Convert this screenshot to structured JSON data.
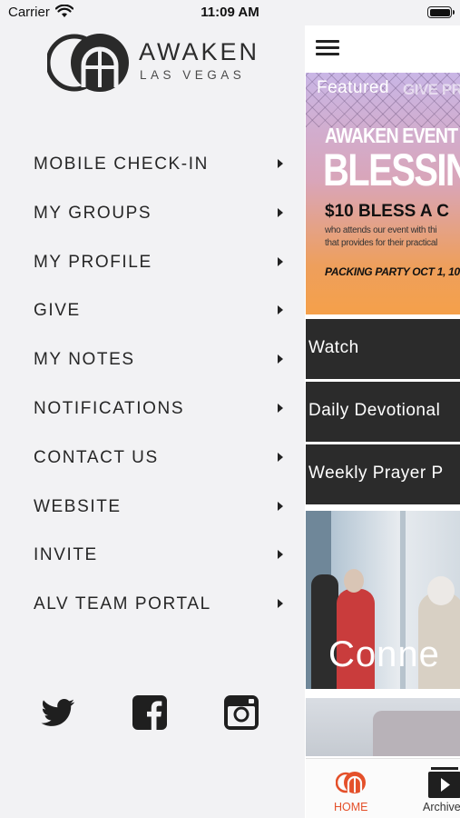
{
  "status_bar": {
    "carrier": "Carrier",
    "time": "11:09 AM"
  },
  "logo": {
    "title": "AWAKEN",
    "subtitle": "LAS VEGAS"
  },
  "menu": [
    {
      "label": "MOBILE CHECK-IN"
    },
    {
      "label": "MY GROUPS"
    },
    {
      "label": "MY PROFILE"
    },
    {
      "label": "GIVE"
    },
    {
      "label": "MY NOTES"
    },
    {
      "label": "NOTIFICATIONS"
    },
    {
      "label": "CONTACT US"
    },
    {
      "label": "WEBSITE"
    },
    {
      "label": "INVITE"
    },
    {
      "label": "ALV TEAM PORTAL"
    }
  ],
  "social": [
    {
      "icon": "twitter-icon"
    },
    {
      "icon": "facebook-icon"
    },
    {
      "icon": "instagram-icon"
    }
  ],
  "featured": {
    "label": "Featured",
    "overlay": "GIVE PRA",
    "event_title": "AWAKEN EVENT",
    "headline": "BLESSING",
    "bless": "$10 BLESS A C",
    "line1": "who attends our event with thi",
    "line2": "that provides for their practical",
    "packing": "PACKING PARTY OCT 1, 10"
  },
  "tiles": [
    {
      "label": "Watch"
    },
    {
      "label": "Daily Devotional"
    },
    {
      "label": "Weekly Prayer P"
    }
  ],
  "connect": {
    "title": "Conne"
  },
  "tabbar": {
    "home": "HOME",
    "archive": "Archive",
    "accent": "#e4502a"
  },
  "colors": {
    "tile_bg": "#2b2b2b",
    "drawer_bg": "#f2f2f4"
  }
}
